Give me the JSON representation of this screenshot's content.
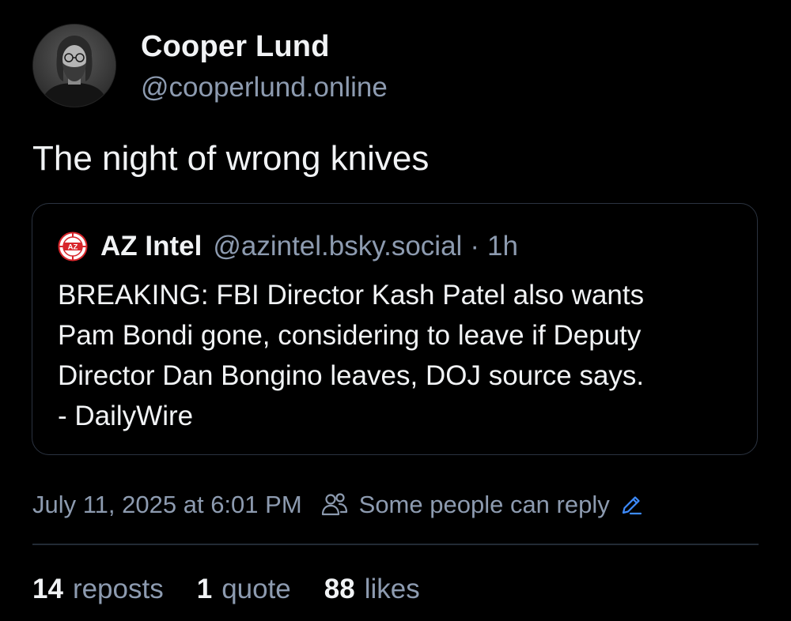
{
  "author": {
    "display_name": "Cooper Lund",
    "handle": "@cooperlund.online"
  },
  "post": {
    "text": "The night of wrong knives"
  },
  "quote": {
    "avatar_text": "AZ",
    "author": "AZ Intel",
    "handle": "@azintel.bsky.social",
    "separator": "·",
    "time": "1h",
    "body_lines": [
      "BREAKING: FBI Director Kash Patel also wants",
      "Pam Bondi gone, considering to leave if Deputy",
      "Director Dan Bongino leaves, DOJ source says.",
      "- DailyWire"
    ]
  },
  "meta": {
    "date": "July 11, 2025 at 6:01 PM",
    "reply_setting": "Some people can reply"
  },
  "stats": {
    "reposts": {
      "count": "14",
      "label": "reposts"
    },
    "quotes": {
      "count": "1",
      "label": "quote"
    },
    "likes": {
      "count": "88",
      "label": "likes"
    }
  },
  "colors": {
    "background": "#000000",
    "primary_text": "#f1f3f5",
    "secondary_text": "#8d9bb0",
    "border": "#2b3340",
    "accent_blue": "#3d8bff",
    "az_red": "#d8262b"
  },
  "icons": {
    "people": "people-icon",
    "edit": "pencil-icon"
  }
}
